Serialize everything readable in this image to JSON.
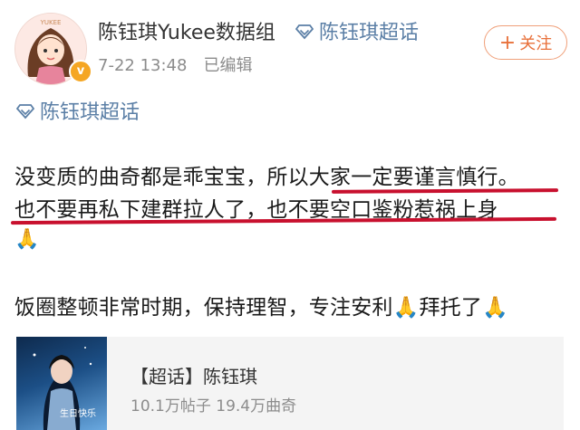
{
  "post": {
    "author": "陈钰琪Yukee数据组",
    "topic_link": "陈钰琪超话",
    "time": "7-22 13:48",
    "edited": "已编辑",
    "follow_label": "关注",
    "topic_tag": "陈钰琪超话",
    "lines": [
      "没变质的曲奇都是乖宝宝，所以大家一定要谨言慎行。",
      "也不要再私下建群拉人了，也不要空口鉴粉惹祸上身",
      "🙏",
      "饭圈整顿非常时期，保持理智，专注安利🙏拜托了🙏"
    ]
  },
  "card": {
    "title": "【超话】陈钰琪",
    "stats": "10.1万帖子 19.4万曲奇",
    "image_caption": "生日快乐"
  },
  "colors": {
    "link": "#5b7fa6",
    "follow": "#e8703a",
    "underline": "#c8102e"
  }
}
